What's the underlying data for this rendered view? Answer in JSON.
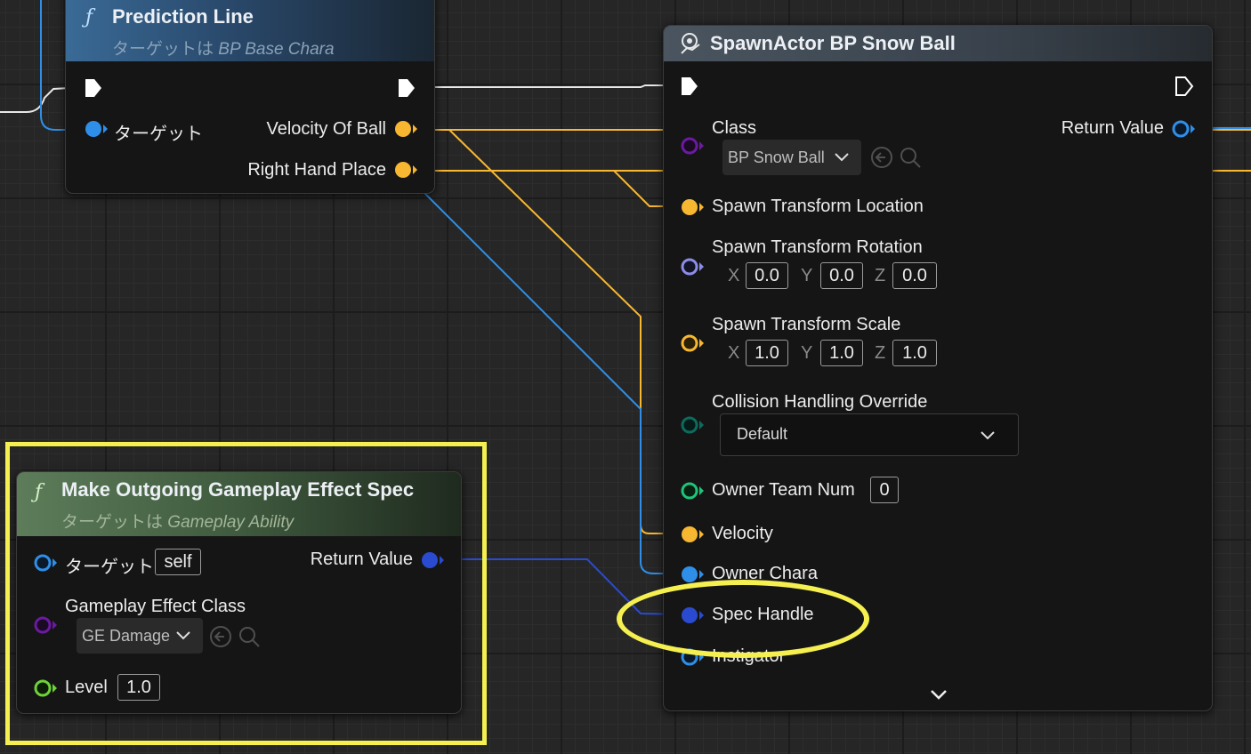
{
  "prediction_node": {
    "title": "Prediction Line",
    "subtitle_prefix": "ターゲットは",
    "subtitle_target": "BP Base Chara",
    "pins": {
      "target_label": "ターゲット",
      "velocity_label": "Velocity Of Ball",
      "right_hand_label": "Right Hand Place"
    },
    "icon": "function-icon"
  },
  "spawn_node": {
    "title": "SpawnActor BP Snow Ball",
    "icon": "spawn-actor-icon",
    "class_label": "Class",
    "class_value": "BP Snow Ball",
    "return_label": "Return Value",
    "location_label": "Spawn Transform Location",
    "rotation_label": "Spawn Transform Rotation",
    "rotation": {
      "x": "0.0",
      "y": "0.0",
      "z": "0.0"
    },
    "scale_label": "Spawn Transform Scale",
    "scale": {
      "x": "1.0",
      "y": "1.0",
      "z": "1.0"
    },
    "axis_labels": {
      "x": "X",
      "y": "Y",
      "z": "Z"
    },
    "collision_label": "Collision Handling Override",
    "collision_value": "Default",
    "owner_team_label": "Owner Team Num",
    "owner_team_value": "0",
    "velocity_label": "Velocity",
    "owner_chara_label": "Owner Chara",
    "spec_handle_label": "Spec Handle",
    "instigator_label": "Instigator",
    "expand_icon": "chevron-down-icon"
  },
  "make_spec_node": {
    "title": "Make Outgoing Gameplay Effect Spec",
    "subtitle_prefix": "ターゲットは",
    "subtitle_target": "Gameplay Ability",
    "target_label": "ターゲット",
    "target_value": "self",
    "return_label": "Return Value",
    "effect_class_label": "Gameplay Effect Class",
    "effect_class_value": "GE Damage",
    "level_label": "Level",
    "level_value": "1.0",
    "icon": "function-icon"
  },
  "colors": {
    "exec": "#ffffff",
    "object_pin": "#2f8fe8",
    "vector_pin": "#f7b731",
    "class_pin": "#6a1ba0",
    "struct_pin": "#2a4bd0",
    "int_pin": "#1fc37a",
    "enum_pin": "#0d6b5e",
    "highlight": "#f5f050"
  }
}
